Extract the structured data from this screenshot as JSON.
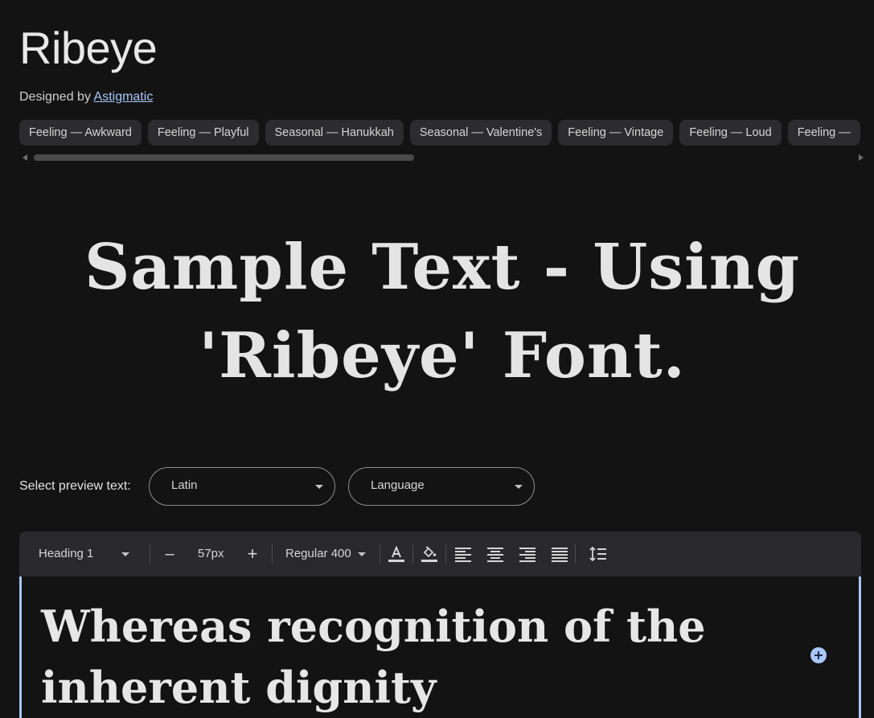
{
  "font": {
    "name": "Ribeye",
    "designed_by_label": "Designed by",
    "designer": "Astigmatic"
  },
  "tags": [
    "Feeling — Awkward",
    "Feeling — Playful",
    "Seasonal — Hanukkah",
    "Seasonal — Valentine's",
    "Feeling — Vintage",
    "Feeling — Loud",
    "Feeling —"
  ],
  "hero": {
    "line1": "Sample Text - Using",
    "line2": "'Ribeye' Font."
  },
  "preview": {
    "label": "Select preview text:",
    "script_value": "Latin",
    "language_value": "Language"
  },
  "toolbar": {
    "style_value": "Heading 1",
    "decrease_label": "–",
    "size_value": "57px",
    "increase_label": "+",
    "weight_value": "Regular 400"
  },
  "editor": {
    "text": "Whereas recognition of the inherent dignity"
  },
  "colors": {
    "background": "#131313",
    "chip": "#2c2c2e",
    "toolbar": "#2a2a2c",
    "accent": "#a8c7fa"
  },
  "icons": {
    "text_color": "text-color-icon",
    "fill_color": "fill-color-icon",
    "align_left": "align-left-icon",
    "align_center": "align-center-icon",
    "align_right": "align-right-icon",
    "align_justify": "align-justify-icon",
    "line_height": "line-height-icon",
    "add": "add-circle-icon"
  }
}
